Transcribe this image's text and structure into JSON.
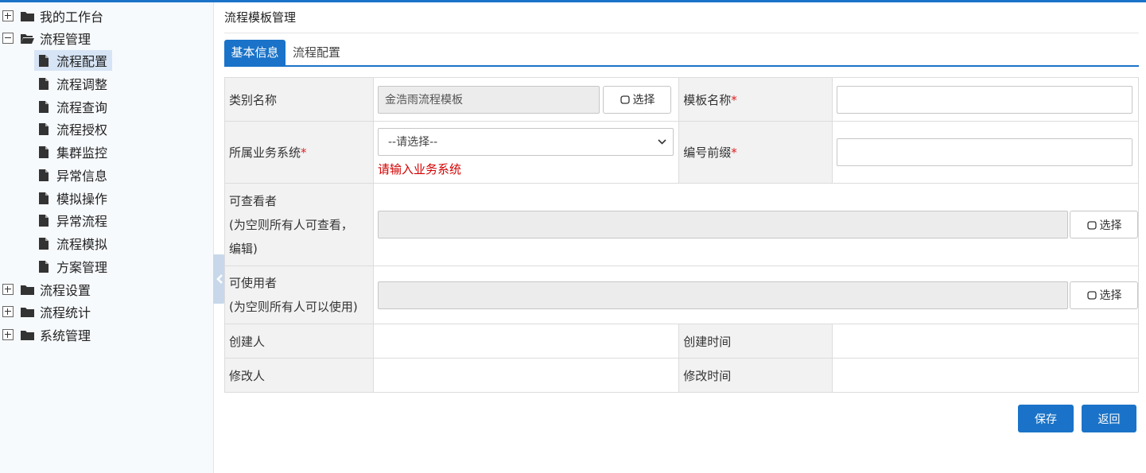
{
  "sidebar": {
    "nodes": [
      {
        "label": "我的工作台",
        "expanded": false
      },
      {
        "label": "流程管理",
        "expanded": true
      },
      {
        "label": "流程设置",
        "expanded": false
      },
      {
        "label": "流程统计",
        "expanded": false
      },
      {
        "label": "系统管理",
        "expanded": false
      }
    ],
    "children": [
      {
        "label": "流程配置",
        "active": true
      },
      {
        "label": "流程调整"
      },
      {
        "label": "流程查询"
      },
      {
        "label": "流程授权"
      },
      {
        "label": "集群监控"
      },
      {
        "label": "异常信息"
      },
      {
        "label": "模拟操作"
      },
      {
        "label": "异常流程"
      },
      {
        "label": "流程模拟"
      },
      {
        "label": "方案管理"
      }
    ]
  },
  "page": {
    "title": "流程模板管理"
  },
  "tabs": [
    {
      "label": "基本信息",
      "active": true
    },
    {
      "label": "流程配置",
      "active": false
    }
  ],
  "form": {
    "category": {
      "label": "类别名称",
      "value": "金浩雨流程模板",
      "button": "选择"
    },
    "template_name": {
      "label": "模板名称",
      "required": "*",
      "value": ""
    },
    "business_system": {
      "label": "所属业务系统",
      "required": "*",
      "selected": "--请选择--",
      "error": "请输入业务系统"
    },
    "code_prefix": {
      "label": "编号前缀",
      "required": "*",
      "value": ""
    },
    "viewers": {
      "label_line1": "可查看者",
      "label_line2": "(为空则所有人可查看，",
      "label_line3": "编辑)",
      "value": "",
      "button": "选择"
    },
    "users": {
      "label_line1": "可使用者",
      "label_line2": "(为空则所有人可以使用)",
      "value": "",
      "button": "选择"
    },
    "creator": {
      "label": "创建人",
      "value": ""
    },
    "create_time": {
      "label": "创建时间",
      "value": ""
    },
    "modifier": {
      "label": "修改人",
      "value": ""
    },
    "modify_time": {
      "label": "修改时间",
      "value": ""
    }
  },
  "actions": {
    "save": "保存",
    "back": "返回"
  },
  "colors": {
    "accent": "#1a73c8",
    "required": "#e02020",
    "error": "#d40000"
  }
}
